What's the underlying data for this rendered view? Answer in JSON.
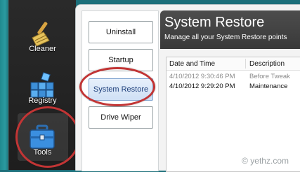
{
  "sidebar": {
    "items": [
      {
        "label": "Cleaner",
        "icon": "broom-icon"
      },
      {
        "label": "Registry",
        "icon": "registry-blocks-icon"
      },
      {
        "label": "Tools",
        "icon": "toolbox-icon",
        "selected": true
      }
    ]
  },
  "tools_tabs": [
    {
      "label": "Uninstall"
    },
    {
      "label": "Startup"
    },
    {
      "label": "System Restore",
      "active": true
    },
    {
      "label": "Drive Wiper"
    }
  ],
  "panel": {
    "title": "System Restore",
    "subtitle": "Manage all your System Restore points"
  },
  "restore_table": {
    "headers": [
      "Date and Time",
      "Description"
    ],
    "rows": [
      {
        "date": "4/10/2012 9:30:46 PM",
        "description": "Before Tweak"
      },
      {
        "date": "4/10/2012 9:29:20 PM",
        "description": "Maintenance"
      }
    ]
  },
  "watermark": "© yethz.com",
  "colors": {
    "annotation_circle": "#c23535",
    "active_tab_text": "#1e3f7a",
    "header_bg": "#404040"
  }
}
